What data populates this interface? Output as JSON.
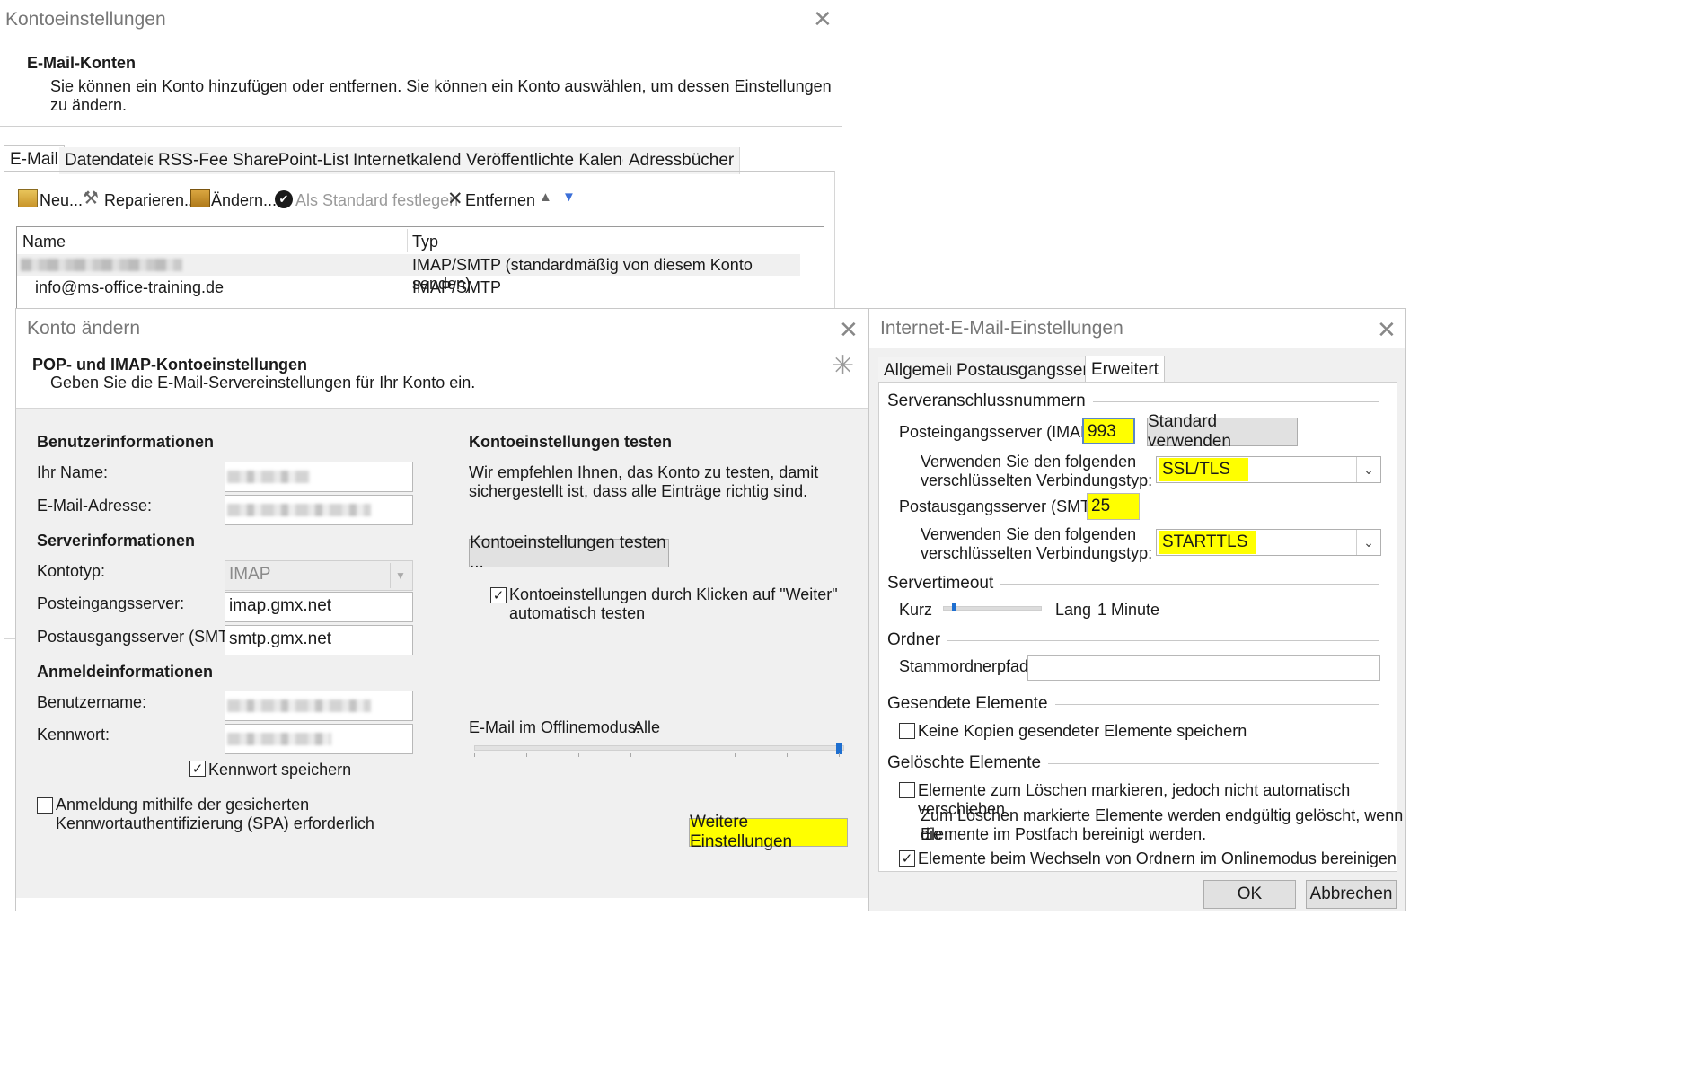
{
  "account_settings": {
    "title": "Kontoeinstellungen",
    "heading": "E-Mail-Konten",
    "description": "Sie können ein Konto hinzufügen oder entfernen. Sie können ein Konto auswählen, um dessen Einstellungen zu ändern.",
    "tabs": [
      "E-Mail",
      "Datendateien",
      "RSS-Feeds",
      "SharePoint-Listen",
      "Internetkalender",
      "Veröffentlichte Kalender",
      "Adressbücher"
    ],
    "toolbar": {
      "new": "Neu...",
      "repair": "Reparieren...",
      "change": "Ändern...",
      "set_default": "Als Standard festlegen",
      "remove": "Entfernen"
    },
    "table": {
      "columns": [
        "Name",
        "Typ"
      ],
      "rows": [
        {
          "name": "",
          "type": "IMAP/SMTP (standardmäßig von diesem Konto senden)"
        },
        {
          "name": "info@ms-office-training.de",
          "type": "IMAP/SMTP"
        }
      ]
    }
  },
  "change_account": {
    "title": "Konto ändern",
    "heading": "POP- und IMAP-Kontoeinstellungen",
    "subheading": "Geben Sie die E-Mail-Servereinstellungen für Ihr Konto ein.",
    "user_info": {
      "heading": "Benutzerinformationen",
      "name_label": "Ihr Name:",
      "email_label": "E-Mail-Adresse:"
    },
    "server_info": {
      "heading": "Serverinformationen",
      "account_type_label": "Kontotyp:",
      "account_type_value": "IMAP",
      "incoming_label": "Posteingangsserver:",
      "incoming_value": "imap.gmx.net",
      "outgoing_label": "Postausgangsserver (SMTP):",
      "outgoing_value": "smtp.gmx.net"
    },
    "login_info": {
      "heading": "Anmeldeinformationen",
      "username_label": "Benutzername:",
      "password_label": "Kennwort:",
      "remember_password": "Kennwort speichern",
      "spa_line1": "Anmeldung mithilfe der gesicherten",
      "spa_line2": "Kennwortauthentifizierung (SPA) erforderlich"
    },
    "test": {
      "heading": "Kontoeinstellungen testen",
      "text_line1": "Wir empfehlen Ihnen, das Konto zu testen, damit",
      "text_line2": "sichergestellt ist, dass alle Einträge richtig sind.",
      "button": "Kontoeinstellungen testen ...",
      "auto_test_line1": "Kontoeinstellungen durch Klicken auf \"Weiter\"",
      "auto_test_line2": "automatisch testen"
    },
    "offline": {
      "label": "E-Mail im Offlinemodus:",
      "value": "Alle",
      "slider_position": 1.0
    },
    "more_settings": "Weitere Einstellungen"
  },
  "internet_settings": {
    "title": "Internet-E-Mail-Einstellungen",
    "tabs": [
      "Allgemein",
      "Postausgangsserver",
      "Erweitert"
    ],
    "server_ports": {
      "heading": "Serveranschlussnummern",
      "imap_label": "Posteingangsserver (IMAP):",
      "imap_value": "993",
      "default_button": "Standard verwenden",
      "encryption_label_1": "Verwenden Sie den folgenden",
      "encryption_label_2": "verschlüsselten Verbindungstyp:",
      "imap_encryption": "SSL/TLS",
      "smtp_label": "Postausgangsserver (SMTP):",
      "smtp_value": "25",
      "smtp_encryption": "STARTTLS"
    },
    "timeout": {
      "heading": "Servertimeout",
      "short": "Kurz",
      "long": "Lang",
      "value": "1 Minute",
      "slider_position": 0.1
    },
    "folders": {
      "heading": "Ordner",
      "root_label": "Stammordnerpfad:",
      "root_value": ""
    },
    "sent": {
      "heading": "Gesendete Elemente",
      "no_copies": "Keine Kopien gesendeter Elemente speichern"
    },
    "deleted": {
      "heading": "Gelöschte Elemente",
      "mark_delete": "Elemente zum Löschen markieren, jedoch nicht automatisch verschieben",
      "note_line1": "Zum Löschen markierte Elemente werden endgültig gelöscht, wenn die",
      "note_line2": "Elemente im Postfach bereinigt werden.",
      "purge": "Elemente beim Wechseln von Ordnern im Onlinemodus bereinigen"
    },
    "ok": "OK",
    "cancel": "Abbrechen"
  },
  "colors": {
    "highlight": "#ffff00",
    "checkmark_icon": "#1a1a1a",
    "arrow_blue": "#3b6fd8"
  }
}
